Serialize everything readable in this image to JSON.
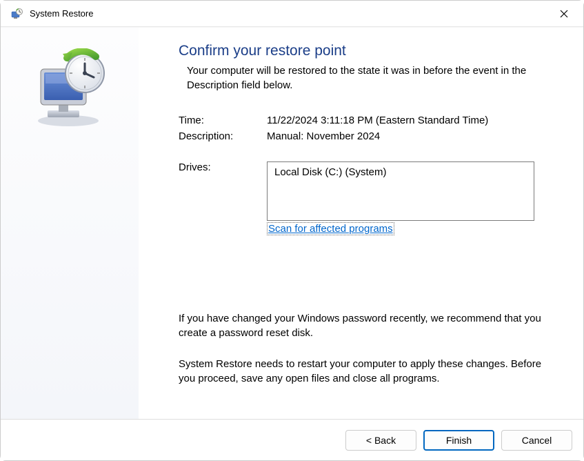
{
  "titlebar": {
    "title": "System Restore"
  },
  "main": {
    "heading": "Confirm your restore point",
    "subheading": "Your computer will be restored to the state it was in before the event in the Description field below.",
    "time_label": "Time:",
    "time_value": "11/22/2024 3:11:18 PM (Eastern Standard Time)",
    "description_label": "Description:",
    "description_value": "Manual: November 2024",
    "drives_label": "Drives:",
    "drives_list": "Local Disk (C:) (System)",
    "scan_link": "Scan for affected programs",
    "password_note": "If you have changed your Windows password recently, we recommend that you create a password reset disk.",
    "restart_note": "System Restore needs to restart your computer to apply these changes. Before you proceed, save any open files and close all programs."
  },
  "footer": {
    "back": "< Back",
    "finish": "Finish",
    "cancel": "Cancel"
  }
}
